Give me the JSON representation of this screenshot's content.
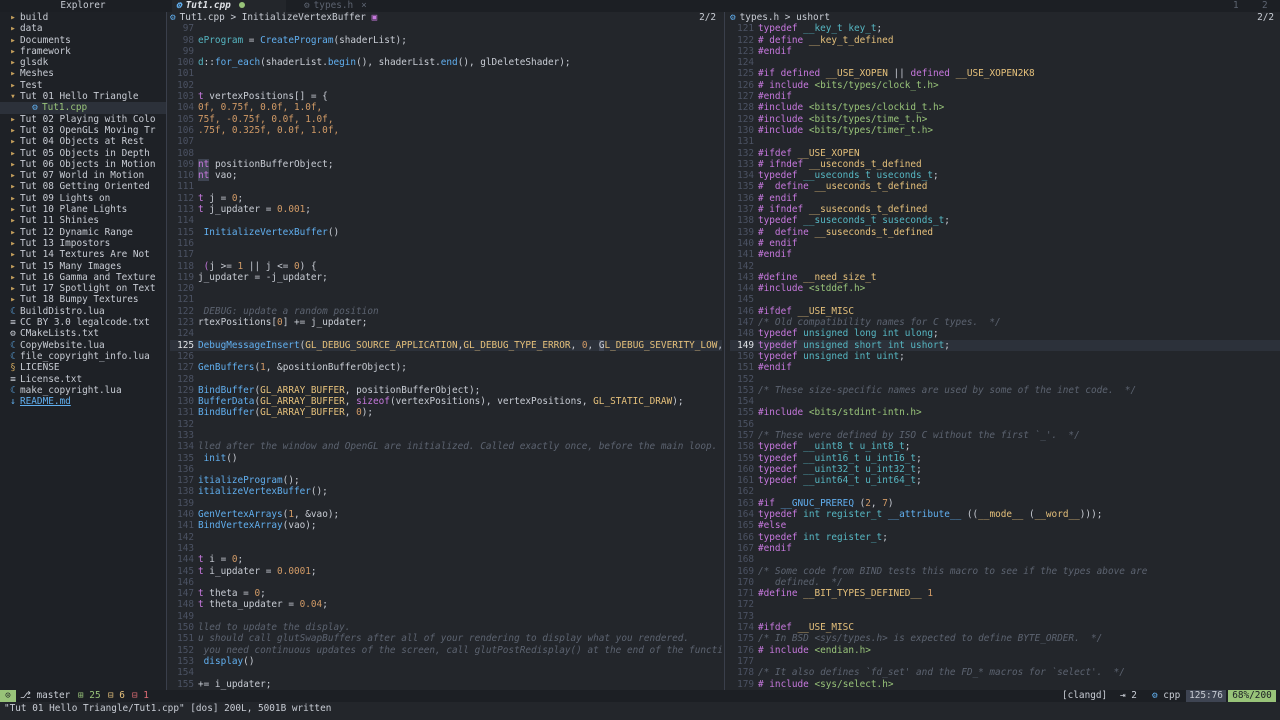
{
  "tabline": {
    "explorer_title": "Explorer",
    "active_tab": "Tut1.cpp",
    "inactive_tab": "types.h",
    "close_glyph": "×",
    "counter_left": "1",
    "counter_right": "2"
  },
  "explorer": {
    "items": [
      {
        "label": "build",
        "icon": "folder-icon",
        "depth": 1
      },
      {
        "label": "data",
        "icon": "folder-icon",
        "depth": 1
      },
      {
        "label": "Documents",
        "icon": "folder-icon",
        "depth": 1
      },
      {
        "label": "framework",
        "icon": "folder-icon",
        "depth": 1
      },
      {
        "label": "glsdk",
        "icon": "folder-icon",
        "depth": 1
      },
      {
        "label": "Meshes",
        "icon": "folder-icon",
        "depth": 1
      },
      {
        "label": "Test",
        "icon": "folder-icon",
        "depth": 1
      },
      {
        "label": "Tut 01 Hello Triangle",
        "icon": "folder-open-icon",
        "depth": 1
      },
      {
        "label": "Tut1.cpp",
        "icon": "cpp-file-icon",
        "depth": 2,
        "selected": true,
        "modified": true
      },
      {
        "label": "Tut 02 Playing with Colo",
        "icon": "folder-icon",
        "depth": 1
      },
      {
        "label": "Tut 03 OpenGLs Moving Tr",
        "icon": "folder-icon",
        "depth": 1
      },
      {
        "label": "Tut 04 Objects at Rest",
        "icon": "folder-icon",
        "depth": 1
      },
      {
        "label": "Tut 05 Objects in Depth",
        "icon": "folder-icon",
        "depth": 1
      },
      {
        "label": "Tut 06 Objects in Motion",
        "icon": "folder-icon",
        "depth": 1
      },
      {
        "label": "Tut 07 World in Motion",
        "icon": "folder-icon",
        "depth": 1
      },
      {
        "label": "Tut 08 Getting Oriented",
        "icon": "folder-icon",
        "depth": 1
      },
      {
        "label": "Tut 09 Lights on",
        "icon": "folder-icon",
        "depth": 1
      },
      {
        "label": "Tut 10 Plane Lights",
        "icon": "folder-icon",
        "depth": 1
      },
      {
        "label": "Tut 11 Shinies",
        "icon": "folder-icon",
        "depth": 1
      },
      {
        "label": "Tut 12 Dynamic Range",
        "icon": "folder-icon",
        "depth": 1
      },
      {
        "label": "Tut 13 Impostors",
        "icon": "folder-icon",
        "depth": 1
      },
      {
        "label": "Tut 14 Textures Are Not",
        "icon": "folder-icon",
        "depth": 1
      },
      {
        "label": "Tut 15 Many Images",
        "icon": "folder-icon",
        "depth": 1
      },
      {
        "label": "Tut 16 Gamma and Texture",
        "icon": "folder-icon",
        "depth": 1
      },
      {
        "label": "Tut 17 Spotlight on Text",
        "icon": "folder-icon",
        "depth": 1
      },
      {
        "label": "Tut 18 Bumpy Textures",
        "icon": "folder-icon",
        "depth": 1
      },
      {
        "label": "BuildDistro.lua",
        "icon": "lua-file-icon",
        "depth": 1
      },
      {
        "label": "CC BY 3.0 legalcode.txt",
        "icon": "text-file-icon",
        "depth": 1
      },
      {
        "label": "CMakeLists.txt",
        "icon": "gear-icon",
        "depth": 1
      },
      {
        "label": "CopyWebsite.lua",
        "icon": "lua-file-icon",
        "depth": 1
      },
      {
        "label": "file_copyright_info.lua",
        "icon": "lua-file-icon",
        "depth": 1
      },
      {
        "label": "LICENSE",
        "icon": "license-icon",
        "depth": 1
      },
      {
        "label": "License.txt",
        "icon": "text-file-icon",
        "depth": 1
      },
      {
        "label": "make_copyright.lua",
        "icon": "lua-file-icon",
        "depth": 1
      },
      {
        "label": "README.md",
        "icon": "markdown-file-icon",
        "depth": 1,
        "readme": true
      }
    ]
  },
  "left_pane": {
    "breadcrumb": "Tut1.cpp > InitializeVertexBuffer",
    "position": "2/2",
    "current_line": "125",
    "lines": [
      {
        "n": "97",
        "html": ""
      },
      {
        "n": "98",
        "html": "<span class='t'>eProgram</span> = <span class='f'>CreateProgram</span>(shaderList);"
      },
      {
        "n": "99",
        "html": ""
      },
      {
        "n": "100",
        "html": "<span class='t'>d</span>::<span class='f'>for_each</span>(shaderList.<span class='f'>begin</span>(), shaderList.<span class='f'>end</span>(), glDeleteShader);"
      },
      {
        "n": "101",
        "html": ""
      },
      {
        "n": "102",
        "html": ""
      },
      {
        "n": "103",
        "html": "<span class='k'>t</span> vertexPositions[] = {"
      },
      {
        "n": "104",
        "html": "<span class='n'>0f, 0.75f, 0.0f, 1.0f,</span>"
      },
      {
        "n": "105",
        "html": "<span class='n'>75f, -0.75f, 0.0f, 1.0f,</span>"
      },
      {
        "n": "106",
        "html": "<span class='n'>.75f, 0.325f, 0.0f, 1.0f,</span>"
      },
      {
        "n": "107",
        "html": ""
      },
      {
        "n": "108",
        "html": ""
      },
      {
        "n": "109",
        "html": "<span class='k hl'>nt</span> positionBufferObject;"
      },
      {
        "n": "110",
        "html": "<span class='k hl'>nt</span> vao;"
      },
      {
        "n": "111",
        "html": ""
      },
      {
        "n": "112",
        "html": "<span class='k'>t</span> j = <span class='n'>0</span>;"
      },
      {
        "n": "113",
        "html": "<span class='k'>t</span> j_updater = <span class='n'>0.001</span>;"
      },
      {
        "n": "114",
        "html": ""
      },
      {
        "n": "115",
        "html": " <span class='f'>InitializeVertexBuffer</span>()"
      },
      {
        "n": "116",
        "html": ""
      },
      {
        "n": "117",
        "html": ""
      },
      {
        "n": "118",
        "html": " <span class='k'>(</span>j &gt;= <span class='n'>1</span> || j &lt;= <span class='n'>0</span>) {"
      },
      {
        "n": "119",
        "html": "j_updater = -j_updater;"
      },
      {
        "n": "120",
        "html": ""
      },
      {
        "n": "121",
        "html": ""
      },
      {
        "n": "122",
        "html": "<span class='c'> DEBUG: update a random position</span>"
      },
      {
        "n": "123",
        "html": "rtexPositions[<span class='n'>0</span>] += j_updater;"
      },
      {
        "n": "124",
        "html": ""
      },
      {
        "n": "125",
        "html": "<span class='f'>DebugMessageInsert</span>(<span class='m'>GL_DEBUG_SOURCE_APPLICATION</span>,<span class='m'>GL_DEBUG_TYPE_ERROR</span>, <span class='n'>0</span>, <span class='hl'>G</span><span class='m'>L_DEBUG_SEVERITY_LOW</span>,)"
      },
      {
        "n": "126",
        "html": ""
      },
      {
        "n": "127",
        "html": "<span class='f'>GenBuffers</span>(<span class='n'>1</span>, &amp;positionBufferObject);"
      },
      {
        "n": "128",
        "html": ""
      },
      {
        "n": "129",
        "html": "<span class='f'>BindBuffer</span>(<span class='m'>GL_ARRAY_BUFFER</span>, positionBufferObject);"
      },
      {
        "n": "130",
        "html": "<span class='f'>BufferData</span>(<span class='m'>GL_ARRAY_BUFFER</span>, <span class='k'>sizeof</span>(vertexPositions), vertexPositions, <span class='m'>GL_STATIC_DRAW</span>);"
      },
      {
        "n": "131",
        "html": "<span class='f'>BindBuffer</span>(<span class='m'>GL_ARRAY_BUFFER</span>, <span class='n'>0</span>);"
      },
      {
        "n": "132",
        "html": ""
      },
      {
        "n": "133",
        "html": ""
      },
      {
        "n": "134",
        "html": "<span class='c'>lled after the window and OpenGL are initialized. Called exactly once, before the main loop.</span>"
      },
      {
        "n": "135",
        "html": " <span class='f'>init</span>()"
      },
      {
        "n": "136",
        "html": ""
      },
      {
        "n": "137",
        "html": "<span class='f'>itializeProgram</span>();"
      },
      {
        "n": "138",
        "html": "<span class='f'>itializeVertexBuffer</span>();"
      },
      {
        "n": "139",
        "html": ""
      },
      {
        "n": "140",
        "html": "<span class='f'>GenVertexArrays</span>(<span class='n'>1</span>, &amp;vao);"
      },
      {
        "n": "141",
        "html": "<span class='f'>BindVertexArray</span>(vao);"
      },
      {
        "n": "142",
        "html": ""
      },
      {
        "n": "143",
        "html": ""
      },
      {
        "n": "144",
        "html": "<span class='k'>t</span> i = <span class='n'>0</span>;"
      },
      {
        "n": "145",
        "html": "<span class='k'>t</span> i_updater = <span class='n'>0.0001</span>;"
      },
      {
        "n": "146",
        "html": ""
      },
      {
        "n": "147",
        "html": "<span class='k'>t</span> theta = <span class='n'>0</span>;"
      },
      {
        "n": "148",
        "html": "<span class='k'>t</span> theta_updater = <span class='n'>0.04</span>;"
      },
      {
        "n": "149",
        "html": ""
      },
      {
        "n": "150",
        "html": "<span class='c'>lled to update the display.</span>"
      },
      {
        "n": "151",
        "html": "<span class='c'>u should call glutSwapBuffers after all of your rendering to display what you rendered.</span>"
      },
      {
        "n": "152",
        "html": "<span class='c'> you need continuous updates of the screen, call glutPostRedisplay() at the end of the function.</span>"
      },
      {
        "n": "153",
        "html": " <span class='f'>display</span>()"
      },
      {
        "n": "154",
        "html": ""
      },
      {
        "n": "155",
        "html": "+= i_updater;"
      }
    ]
  },
  "right_pane": {
    "breadcrumb": "types.h > ushort",
    "position": "2/2",
    "current_line": "149",
    "lines": [
      {
        "n": "121",
        "html": "<span class='k'>typedef</span> <span class='t'>__key_t key_t</span>;"
      },
      {
        "n": "122",
        "html": "<span class='p'># define</span> <span class='m'>__key_t_defined</span>"
      },
      {
        "n": "123",
        "html": "<span class='p'>#endif</span>"
      },
      {
        "n": "124",
        "html": ""
      },
      {
        "n": "125",
        "html": "<span class='p'>#if</span> <span class='k'>defined</span> <span class='m'>__USE_XOPEN</span> || <span class='k'>defined</span> <span class='m'>__USE_XOPEN2K8</span>"
      },
      {
        "n": "126",
        "html": "<span class='p'># include</span> <span class='s'>&lt;bits/types/clock_t.h&gt;</span>"
      },
      {
        "n": "127",
        "html": "<span class='p'>#endif</span>"
      },
      {
        "n": "128",
        "html": "<span class='p'>#include</span> <span class='s'>&lt;bits/types/clockid_t.h&gt;</span>"
      },
      {
        "n": "129",
        "html": "<span class='p'>#include</span> <span class='s'>&lt;bits/types/time_t.h&gt;</span>"
      },
      {
        "n": "130",
        "html": "<span class='p'>#include</span> <span class='s'>&lt;bits/types/timer_t.h&gt;</span>"
      },
      {
        "n": "131",
        "html": ""
      },
      {
        "n": "132",
        "html": "<span class='p'>#ifdef</span> <span class='m'>__USE_XOPEN</span>"
      },
      {
        "n": "133",
        "html": "<span class='p'># ifndef</span> <span class='m'>__useconds_t_defined</span>"
      },
      {
        "n": "134",
        "html": "<span class='k'>typedef</span> <span class='t'>__useconds_t useconds_t</span>;"
      },
      {
        "n": "135",
        "html": "<span class='p'>#  define</span> <span class='m'>__useconds_t_defined</span>"
      },
      {
        "n": "136",
        "html": "<span class='p'># endif</span>"
      },
      {
        "n": "137",
        "html": "<span class='p'># ifndef</span> <span class='m'>__suseconds_t_defined</span>"
      },
      {
        "n": "138",
        "html": "<span class='k'>typedef</span> <span class='t'>__suseconds_t suseconds_t</span>;"
      },
      {
        "n": "139",
        "html": "<span class='p'>#  define</span> <span class='m'>__suseconds_t_defined</span>"
      },
      {
        "n": "140",
        "html": "<span class='p'># endif</span>"
      },
      {
        "n": "141",
        "html": "<span class='p'>#endif</span>"
      },
      {
        "n": "142",
        "html": ""
      },
      {
        "n": "143",
        "html": "<span class='p'>#define</span> <span class='m'>__need_size_t</span>"
      },
      {
        "n": "144",
        "html": "<span class='p'>#include</span> <span class='s'>&lt;stddef.h&gt;</span>"
      },
      {
        "n": "145",
        "html": ""
      },
      {
        "n": "146",
        "html": "<span class='p'>#ifdef</span> <span class='m'>__USE_MISC</span>"
      },
      {
        "n": "147",
        "html": "<span class='c'>/* Old compatibility names for C types.  */</span>"
      },
      {
        "n": "148",
        "html": "<span class='k'>typedef</span> <span class='t'>unsigned long int ulong</span>;"
      },
      {
        "n": "149",
        "html": "<span class='k'>typedef</span> <span class='t'>unsigned short int ushort</span>;"
      },
      {
        "n": "150",
        "html": "<span class='k'>typedef</span> <span class='t'>unsigned int uint</span>;"
      },
      {
        "n": "151",
        "html": "<span class='p'>#endif</span>"
      },
      {
        "n": "152",
        "html": ""
      },
      {
        "n": "153",
        "html": "<span class='c'>/* These size-specific names are used by some of the inet code.  */</span>"
      },
      {
        "n": "154",
        "html": ""
      },
      {
        "n": "155",
        "html": "<span class='p'>#include</span> <span class='s'>&lt;bits/stdint-intn.h&gt;</span>"
      },
      {
        "n": "156",
        "html": ""
      },
      {
        "n": "157",
        "html": "<span class='c'>/* These were defined by ISO C without the first `_'.  */</span>"
      },
      {
        "n": "158",
        "html": "<span class='k'>typedef</span> <span class='t'>__uint8_t u_int8_t</span>;"
      },
      {
        "n": "159",
        "html": "<span class='k'>typedef</span> <span class='t'>__uint16_t u_int16_t</span>;"
      },
      {
        "n": "160",
        "html": "<span class='k'>typedef</span> <span class='t'>__uint32_t u_int32_t</span>;"
      },
      {
        "n": "161",
        "html": "<span class='k'>typedef</span> <span class='t'>__uint64_t u_int64_t</span>;"
      },
      {
        "n": "162",
        "html": ""
      },
      {
        "n": "163",
        "html": "<span class='p'>#if</span> <span class='f'>__GNUC_PREREQ</span> (<span class='n'>2</span>, <span class='n'>7</span>)"
      },
      {
        "n": "164",
        "html": "<span class='k'>typedef</span> <span class='t'>int register_t</span> <span class='f'>__attribute__</span> ((<span class='m'>__mode__</span> (<span class='m'>__word__</span>)));"
      },
      {
        "n": "165",
        "html": "<span class='p'>#else</span>"
      },
      {
        "n": "166",
        "html": "<span class='k'>typedef</span> <span class='t'>int register_t</span>;"
      },
      {
        "n": "167",
        "html": "<span class='p'>#endif</span>"
      },
      {
        "n": "168",
        "html": ""
      },
      {
        "n": "169",
        "html": "<span class='c'>/* Some code from BIND tests this macro to see if the types above are</span>"
      },
      {
        "n": "170",
        "html": "<span class='c'>   defined.  */</span>"
      },
      {
        "n": "171",
        "html": "<span class='p'>#define</span> <span class='m'>__BIT_TYPES_DEFINED__</span> <span class='n'>1</span>"
      },
      {
        "n": "172",
        "html": ""
      },
      {
        "n": "173",
        "html": ""
      },
      {
        "n": "174",
        "html": "<span class='p'>#ifdef</span> <span class='m'>__USE_MISC</span>"
      },
      {
        "n": "175",
        "html": "<span class='c'>/* In BSD &lt;sys/types.h&gt; is expected to define BYTE_ORDER.  */</span>"
      },
      {
        "n": "176",
        "html": "<span class='p'># include</span> <span class='s'>&lt;endian.h&gt;</span>"
      },
      {
        "n": "177",
        "html": ""
      },
      {
        "n": "178",
        "html": "<span class='c'>/* It also defines `fd_set' and the FD_* macros for `select'.  */</span>"
      },
      {
        "n": "179",
        "html": "<span class='p'># include</span> <span class='s'>&lt;sys/select.h&gt;</span>"
      }
    ]
  },
  "statusline": {
    "mode": "⊙",
    "branch": "master",
    "diag_ok": "25",
    "diag_warn": "6",
    "diag_err": "1",
    "lsp": "[clangd]",
    "indent": "⇥ 2",
    "filetype": "cpp",
    "cursor": "125:76",
    "percent": "68%/200"
  },
  "cmdline": "\"Tut 01 Hello Triangle/Tut1.cpp\" [dos] 200L, 5001B written",
  "colors": {
    "background": "#23262b",
    "accent_green": "#98c379",
    "keyword": "#c678dd",
    "function": "#61afef",
    "string": "#98c379",
    "number": "#d19a66"
  }
}
